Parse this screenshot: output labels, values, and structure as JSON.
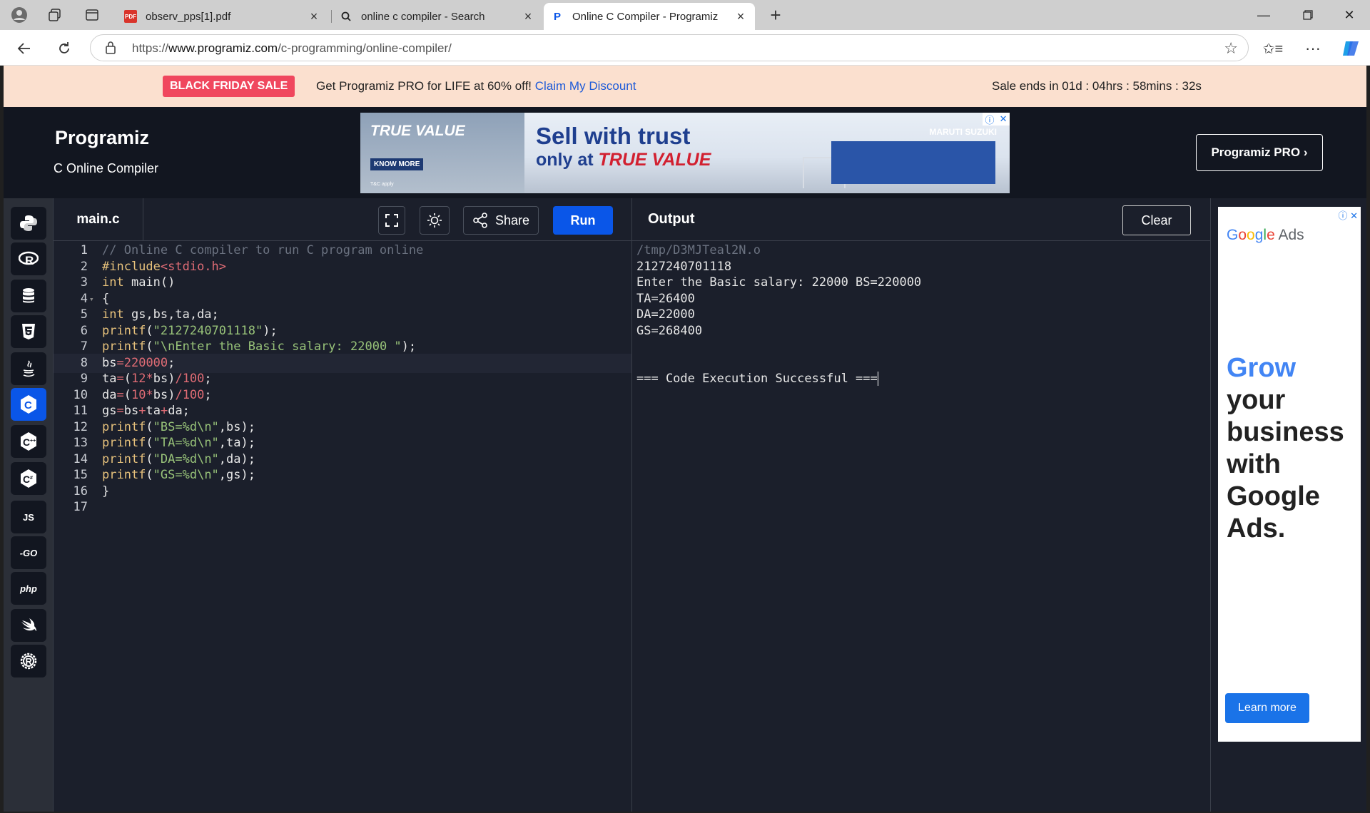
{
  "browser": {
    "tabs": [
      {
        "title": "observ_pps[1].pdf"
      },
      {
        "title": "online c compiler - Search"
      },
      {
        "title": "Online C Compiler - Programiz"
      }
    ],
    "url_prefix": "https://",
    "url_domain": "www.programiz.com",
    "url_path": "/c-programming/online-compiler/"
  },
  "promo": {
    "badge": "BLACK FRIDAY SALE",
    "message": "Get Programiz PRO for LIFE at 60% off!",
    "link": "Claim My Discount",
    "timer": "Sale ends in 01d : 04hrs : 58mins : 32s"
  },
  "header": {
    "logo": "Programiz",
    "subtitle": "C Online Compiler",
    "pro_button": "Programiz PRO ›",
    "ad": {
      "brand": "TRUE VALUE",
      "cta": "KNOW MORE",
      "note": "T&C apply",
      "headline1": "Sell with trust",
      "headline2_pre": "only at ",
      "headline2_brand": "TRUE VALUE",
      "partner": "MARUTI SUZUKI"
    }
  },
  "sidebar": {
    "languages": [
      "python",
      "r",
      "sql",
      "html",
      "java",
      "c",
      "cpp",
      "csharp",
      "javascript",
      "go",
      "php",
      "swift",
      "rust"
    ],
    "active": "c",
    "js_label": "JS",
    "go_label": "-GO",
    "php_label": "php"
  },
  "editor": {
    "filename": "main.c",
    "share_label": "Share",
    "run_label": "Run",
    "lines": [
      "// Online C compiler to run C program online",
      "#include<stdio.h>",
      "int main()",
      "{",
      "int gs,bs,ta,da;",
      "printf(\"2127240701118\");",
      "printf(\"\\nEnter the Basic salary: 22000 \");",
      "bs=220000;",
      "ta=(12*bs)/100;",
      "da=(10*bs)/100;",
      "gs=bs+ta+da;",
      "printf(\"BS=%d\\n\",bs);",
      "printf(\"TA=%d\\n\",ta);",
      "printf(\"DA=%d\\n\",da);",
      "printf(\"GS=%d\\n\",gs);",
      "}",
      ""
    ]
  },
  "output": {
    "title": "Output",
    "clear_label": "Clear",
    "path": "/tmp/D3MJTeal2N.o",
    "lines": [
      "2127240701118",
      "Enter the Basic salary: 22000 BS=220000",
      "TA=26400",
      "DA=22000",
      "GS=268400",
      "",
      "",
      "=== Code Execution Successful ==="
    ]
  },
  "right_ad": {
    "brand": "Google Ads",
    "grow": "Grow",
    "rest": "your business with Google Ads.",
    "cta": "Learn more"
  }
}
